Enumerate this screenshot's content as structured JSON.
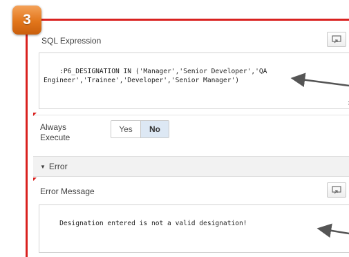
{
  "callout": {
    "step_number": "3",
    "accent_color": "#d9211f",
    "badge_color": "#e2761b"
  },
  "sql_expression": {
    "label": "SQL Expression",
    "expand_icon": "expand-icon",
    "value": ":P6_DESIGNATION IN ('Manager','Senior Developer','QA\nEngineer','Trainee','Developer','Senior Manager')"
  },
  "always_execute": {
    "label_line1": "Always",
    "label_line2": "Execute",
    "options": [
      "Yes",
      "No"
    ],
    "selected": "No"
  },
  "error_region": {
    "title": "Error",
    "collapse_icon": "triangle-down-icon"
  },
  "error_message": {
    "label": "Error Message",
    "expand_icon": "expand-icon",
    "value": "Designation entered is not a valid designation!"
  }
}
